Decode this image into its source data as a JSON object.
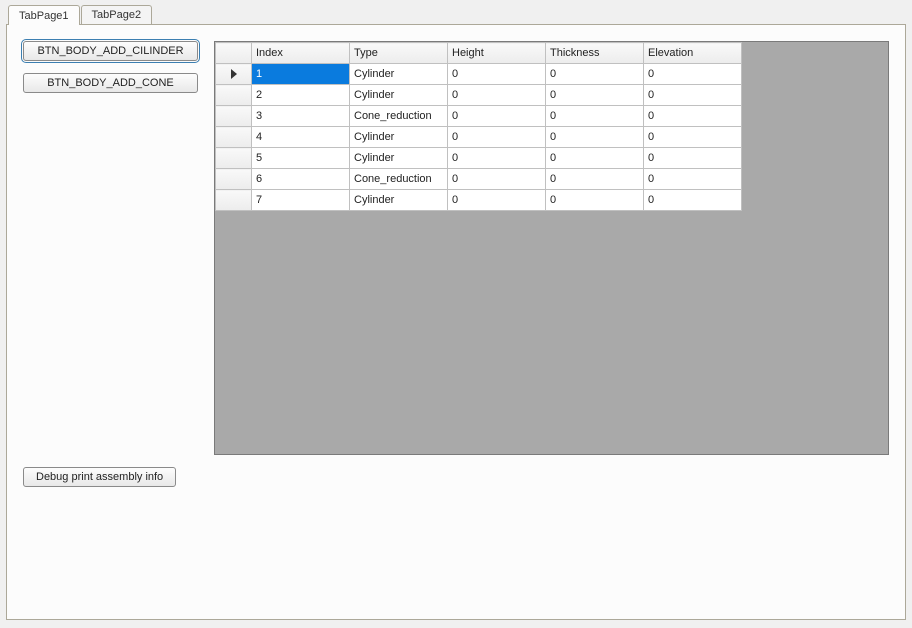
{
  "tabs": [
    {
      "label": "TabPage1",
      "active": true
    },
    {
      "label": "TabPage2",
      "active": false
    }
  ],
  "left_panel": {
    "btn_cilinder": "BTN_BODY_ADD_CILINDER",
    "btn_cone": "BTN_BODY_ADD_CONE"
  },
  "grid": {
    "columns": [
      "Index",
      "Type",
      "Height",
      "Thickness",
      "Elevation"
    ],
    "rows": [
      {
        "index": "1",
        "type": "Cylinder",
        "height": "0",
        "thickness": "0",
        "elevation": "0",
        "selected_cell": "index",
        "current": true
      },
      {
        "index": "2",
        "type": "Cylinder",
        "height": "0",
        "thickness": "0",
        "elevation": "0"
      },
      {
        "index": "3",
        "type": "Cone_reduction",
        "height": "0",
        "thickness": "0",
        "elevation": "0"
      },
      {
        "index": "4",
        "type": "Cylinder",
        "height": "0",
        "thickness": "0",
        "elevation": "0"
      },
      {
        "index": "5",
        "type": "Cylinder",
        "height": "0",
        "thickness": "0",
        "elevation": "0"
      },
      {
        "index": "6",
        "type": "Cone_reduction",
        "height": "0",
        "thickness": "0",
        "elevation": "0"
      },
      {
        "index": "7",
        "type": "Cylinder",
        "height": "0",
        "thickness": "0",
        "elevation": "0"
      }
    ]
  },
  "bottom": {
    "btn_debug": "Debug print assembly info"
  }
}
